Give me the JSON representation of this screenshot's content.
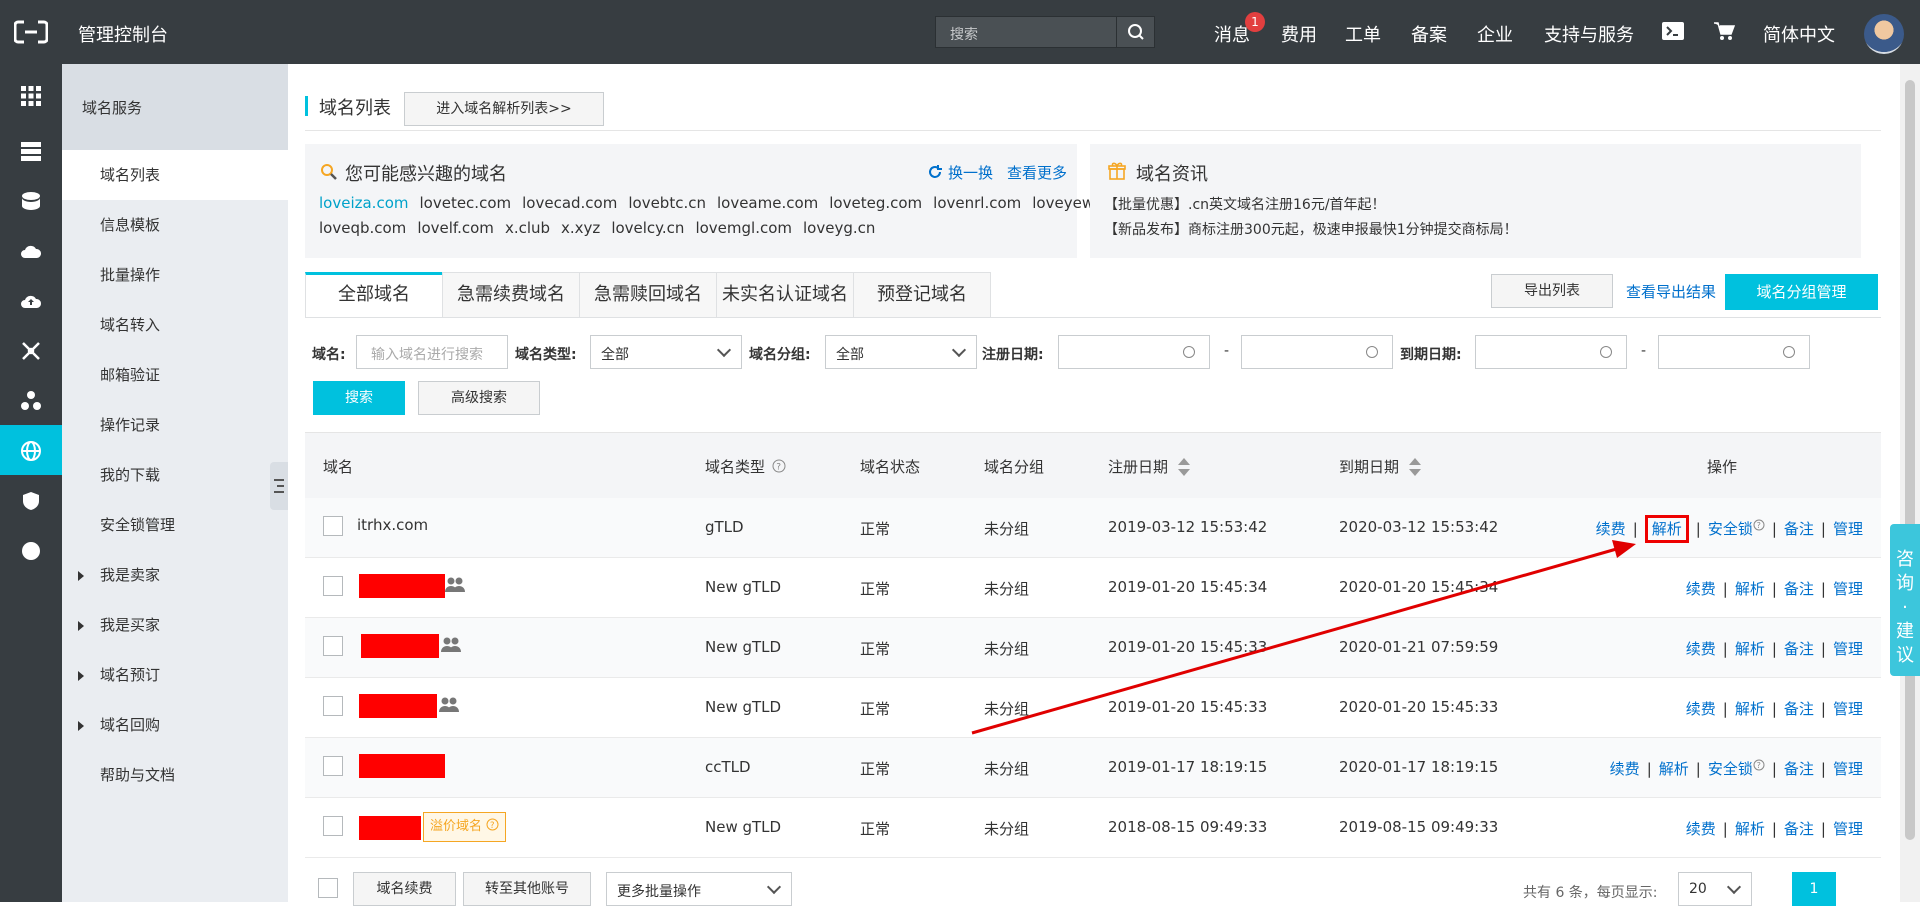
{
  "topbar": {
    "title": "管理控制台",
    "search_placeholder": "搜索",
    "nav": [
      "消息",
      "费用",
      "工单",
      "备案",
      "企业",
      "支持与服务",
      "简体中文"
    ],
    "message_badge": "1"
  },
  "sidebar": {
    "title": "域名服务",
    "items": [
      {
        "label": "域名列表",
        "active": true
      },
      {
        "label": "信息模板"
      },
      {
        "label": "批量操作"
      },
      {
        "label": "域名转入"
      },
      {
        "label": "邮箱验证"
      },
      {
        "label": "操作记录"
      },
      {
        "label": "我的下载"
      },
      {
        "label": "安全锁管理"
      },
      {
        "label": "我是卖家",
        "expandable": true
      },
      {
        "label": "我是买家",
        "expandable": true
      },
      {
        "label": "域名预订",
        "expandable": true
      },
      {
        "label": "域名回购",
        "expandable": true
      },
      {
        "label": "帮助与文档"
      }
    ]
  },
  "page": {
    "title": "域名列表",
    "goto_dns_label": "进入域名解析列表>>"
  },
  "interest": {
    "title": "您可能感兴趣的域名",
    "refresh_label": "换一换",
    "more_label": "查看更多",
    "row1": [
      "loveiza.com",
      "lovetec.com",
      "lovecad.com",
      "lovebtc.cn",
      "loveame.com",
      "loveteg.com",
      "lovenrl.com",
      "loveyew.com"
    ],
    "row2": [
      "loveqb.com",
      "lovelf.com",
      "x.club",
      "x.xyz",
      "lovelcy.cn",
      "lovemgl.com",
      "loveyg.cn"
    ]
  },
  "news": {
    "title": "域名资讯",
    "items": [
      "【批量优惠】.cn英文域名注册16元/首年起！",
      "【新品发布】商标注册300元起，极速申报最快1分钟提交商标局！"
    ]
  },
  "tabs": [
    "全部域名",
    "急需续费域名",
    "急需赎回域名",
    "未实名认证域名",
    "预登记域名"
  ],
  "actions": {
    "export_list": "导出列表",
    "view_export": "查看导出结果",
    "group_manage": "域名分组管理"
  },
  "filters": {
    "domain_label": "域名:",
    "domain_placeholder": "输入域名进行搜索",
    "type_label": "域名类型:",
    "type_value": "全部",
    "group_label": "域名分组:",
    "group_value": "全部",
    "reg_label": "注册日期:",
    "exp_label": "到期日期:",
    "range_sep": "-",
    "search_btn": "搜索",
    "advanced_btn": "高级搜索"
  },
  "table": {
    "headers": {
      "domain": "域名",
      "type": "域名类型",
      "status": "域名状态",
      "group": "域名分组",
      "reg": "注册日期",
      "exp": "到期日期",
      "ops": "操作"
    },
    "rows": [
      {
        "domain": "itrhx.com",
        "type": "gTLD",
        "status": "正常",
        "group": "未分组",
        "reg": "2019-03-12 15:53:42",
        "exp": "2020-03-12 15:53:42",
        "ops": [
          "续费",
          "解析",
          "安全锁",
          "备注",
          "管理"
        ]
      },
      {
        "domain": "",
        "type": "New gTLD",
        "status": "正常",
        "group": "未分组",
        "reg": "2019-01-20 15:45:34",
        "exp": "2020-01-20 15:45:34",
        "ops": [
          "续费",
          "解析",
          "备注",
          "管理"
        ]
      },
      {
        "domain": "",
        "type": "New gTLD",
        "status": "正常",
        "group": "未分组",
        "reg": "2019-01-20 15:45:33",
        "exp": "2020-01-21 07:59:59",
        "ops": [
          "续费",
          "解析",
          "备注",
          "管理"
        ]
      },
      {
        "domain": "",
        "type": "New gTLD",
        "status": "正常",
        "group": "未分组",
        "reg": "2019-01-20 15:45:33",
        "exp": "2020-01-20 15:45:33",
        "ops": [
          "续费",
          "解析",
          "备注",
          "管理"
        ]
      },
      {
        "domain": "",
        "type": "ccTLD",
        "status": "正常",
        "group": "未分组",
        "reg": "2019-01-17 18:19:15",
        "exp": "2020-01-17 18:19:15",
        "ops": [
          "续费",
          "解析",
          "安全锁",
          "备注",
          "管理"
        ]
      },
      {
        "domain": "",
        "type": "New gTLD",
        "status": "正常",
        "group": "未分组",
        "reg": "2018-08-15 09:49:33",
        "exp": "2019-08-15 09:49:33",
        "ops": [
          "续费",
          "解析",
          "备注",
          "管理"
        ],
        "badge": "溢价域名"
      }
    ]
  },
  "footer": {
    "renew_btn": "域名续费",
    "transfer_btn": "转至其他账号",
    "batch_select": "更多批量操作",
    "summary": "共有 6 条，每页显示:",
    "page_size": "20",
    "current_page": "1"
  },
  "consult": "咨询·建议",
  "colors": {
    "accent": "#00c1de",
    "topbar": "#373d41",
    "link": "#0070cc",
    "annotation": "#e00000"
  }
}
